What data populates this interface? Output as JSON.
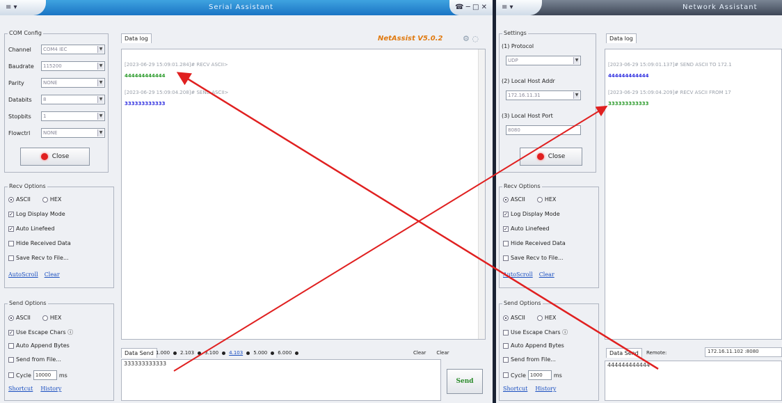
{
  "left": {
    "menu_label": "≡ ▾",
    "title": "Serial Assistant",
    "controls": "☎ ─ □ ✕",
    "com_config": {
      "title": "COM Config",
      "fields": [
        {
          "label": "Channel",
          "value": "COM4 IEC"
        },
        {
          "label": "Baudrate",
          "value": "115200"
        },
        {
          "label": "Parity",
          "value": "NONE"
        },
        {
          "label": "Databits",
          "value": "8"
        },
        {
          "label": "Stopbits",
          "value": "1"
        },
        {
          "label": "Flowctrl",
          "value": "NONE"
        }
      ],
      "close_label": "Close"
    },
    "recv_options": {
      "title": "Recv Options",
      "ascii": "ASCII",
      "hex": "HEX",
      "items": [
        "Log Display Mode",
        "Auto Linefeed",
        "Hide Received Data",
        "Save Recv to File..."
      ],
      "checked": [
        true,
        true,
        false,
        false
      ],
      "autoscroll": "AutoScroll",
      "clear": "Clear"
    },
    "send_options": {
      "title": "Send Options",
      "ascii": "ASCII",
      "hex": "HEX",
      "items": [
        "Use Escape Chars ⓘ",
        "Auto Append Bytes",
        "Send from File..."
      ],
      "checked": [
        true,
        false,
        false
      ],
      "cycle_label": "Cycle",
      "cycle_value": "10000",
      "cycle_unit": "ms",
      "shortcut": "Shortcut",
      "history": "History"
    },
    "data_log_tab": "Data log",
    "brand": "NetAssist V5.0.2",
    "brand_icons": "⚙ ◌",
    "log_lines": [
      {
        "text": "[2023-06-29 15:09:01.284]# RECV ASCII>",
        "kind": "gray"
      },
      {
        "text": "444444444444",
        "kind": "green"
      },
      {
        "text": "[2023-06-29 15:09:04.208]# SEND ASCII>",
        "kind": "gray"
      },
      {
        "text": "333333333333",
        "kind": "blue"
      }
    ],
    "data_send_tab": "Data Send",
    "quick_sends": [
      "1.000",
      "2.103",
      "3.100",
      "4.103",
      "5.000",
      "6.000"
    ],
    "clear1": "Clear",
    "clear2": "Clear",
    "send_input": "333333333333",
    "send_button": "Send"
  },
  "right": {
    "menu_label": "≡ ▾",
    "title": "Network Assistant",
    "settings": {
      "title": "Settings",
      "protocol_label": "(1) Protocol",
      "protocol_value": "UDP",
      "host_addr_label": "(2) Local Host Addr",
      "host_addr_value": "172.16.11.31",
      "host_port_label": "(3) Local Host Port",
      "host_port_value": "8080",
      "close_label": "Close"
    },
    "recv_options": {
      "title": "Recv Options",
      "ascii": "ASCII",
      "hex": "HEX",
      "items": [
        "Log Display Mode",
        "Auto Linefeed",
        "Hide Received Data",
        "Save Recv to File..."
      ],
      "checked": [
        true,
        true,
        false,
        false
      ],
      "autoscroll": "AutoScroll",
      "clear": "Clear"
    },
    "send_options": {
      "title": "Send Options",
      "ascii": "ASCII",
      "hex": "HEX",
      "items": [
        "Use Escape Chars ⓘ",
        "Auto Append Bytes",
        "Send from File..."
      ],
      "checked": [
        false,
        false,
        false
      ],
      "cycle_label": "Cycle",
      "cycle_value": "1000",
      "cycle_unit": "ms",
      "shortcut": "Shortcut",
      "history": "History"
    },
    "data_log_tab": "Data log",
    "log_lines": [
      {
        "text": "[2023-06-29 15:09:01.137]# SEND ASCII TO 172.1",
        "kind": "gray"
      },
      {
        "text": "444444444444",
        "kind": "blue"
      },
      {
        "text": "[2023-06-29 15:09:04.209]# RECV ASCII FROM 17",
        "kind": "gray"
      },
      {
        "text": "333333333333",
        "kind": "green"
      }
    ],
    "data_send_tab": "Data Send",
    "remote_label": "Remote:",
    "remote_value": "172.16.11.102 :8080",
    "send_input": "444444444444"
  }
}
